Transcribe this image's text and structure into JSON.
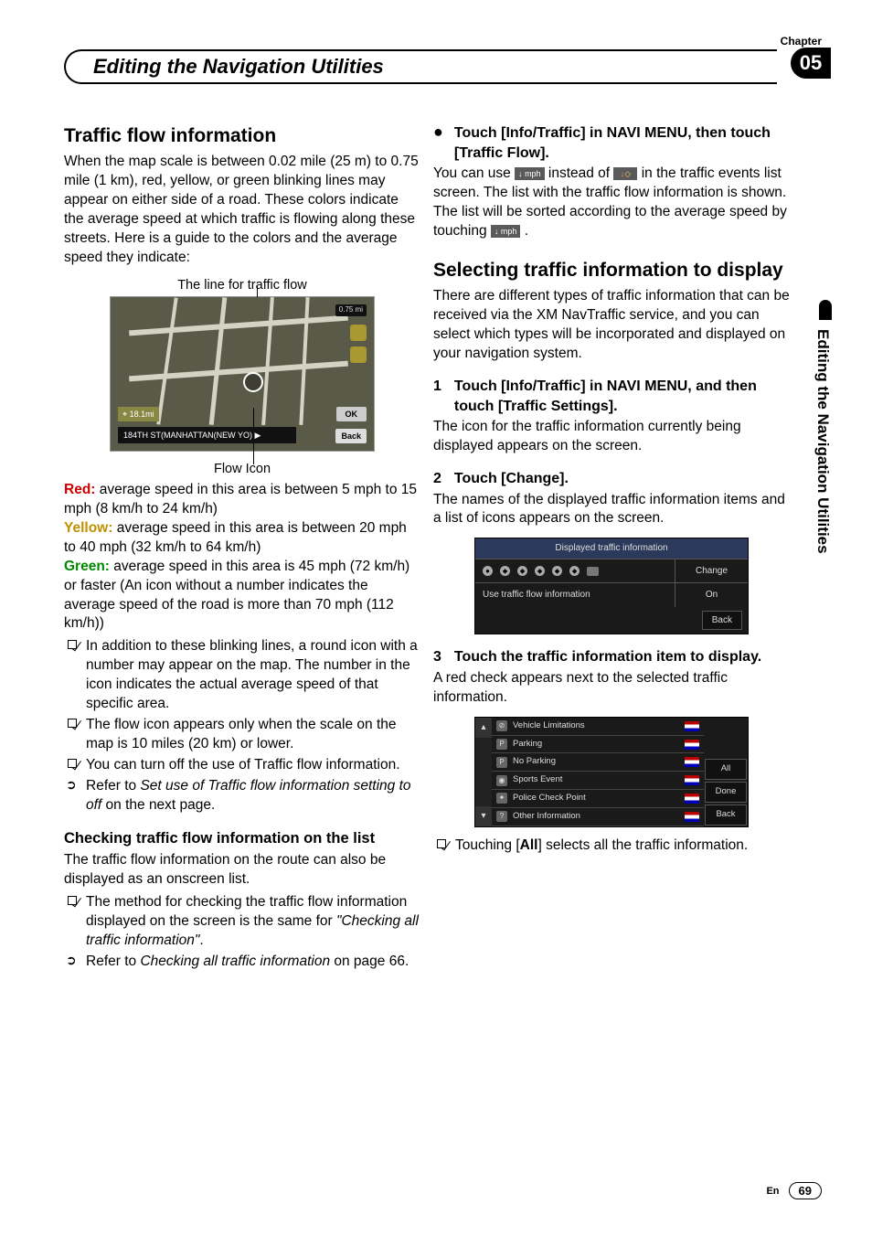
{
  "header": {
    "chapter_label": "Chapter",
    "chapter_number": "05",
    "title": "Editing the Navigation Utilities"
  },
  "side_tab": "Editing the Navigation Utilities",
  "left": {
    "h_traffic": "Traffic flow information",
    "p1": "When the map scale is between 0.02 mile (25 m) to 0.75 mile (1 km), red, yellow, or green blinking lines may appear on either side of a road. These colors indicate the average speed at which traffic is flowing along these streets. Here is a guide to the colors and the average speed they indicate:",
    "fig1_caption_top": "The line for traffic flow",
    "fig1_caption_bottom": "Flow Icon",
    "map": {
      "scale": "0.75 mi",
      "dist": "⌖ 18.1mi",
      "street": "184TH ST(MANHATTAN(NEW YO) ▶",
      "ok": "OK",
      "back": "Back"
    },
    "red_label": "Red:",
    "red_text": " average speed in this area is between 5 mph to 15 mph (8 km/h to 24 km/h)",
    "yellow_label": "Yellow:",
    "yellow_text": " average speed in this area is between 20 mph to 40 mph (32 km/h to 64 km/h)",
    "green_label": "Green:",
    "green_text": " average speed in this area is 45 mph (72 km/h) or faster (An icon without a number indicates the average speed of the road is more than 70 mph (112 km/h))",
    "notes": [
      "In addition to these blinking lines, a round icon with a number may appear on the map. The number in the icon indicates the actual average speed of that specific area.",
      "The flow icon appears only when the scale on the map is 10 miles (20 km) or lower.",
      "You can turn off the use of Traffic flow information."
    ],
    "refer1a": "Refer to ",
    "refer1b": "Set use of Traffic flow information setting to off",
    "refer1c": " on the next page.",
    "h_checking": "Checking traffic flow information on the list",
    "p_checking": "The traffic flow information on the route can also be displayed as an onscreen list.",
    "note_checking_a": "The method for checking the traffic flow information displayed on the screen is the same for ",
    "note_checking_b": "\"Checking all traffic information\"",
    "note_checking_c": ".",
    "refer2a": "Refer to ",
    "refer2b": "Checking all traffic information",
    "refer2c": " on page 66."
  },
  "right": {
    "step_bullet": "Touch [Info/Traffic] in NAVI MENU, then touch [Traffic Flow].",
    "p_use_a": "You can use ",
    "p_use_b": " instead of ",
    "p_use_c": " in the traffic events list screen. The list with the traffic flow information is shown.",
    "p_sort_a": "The list will be sorted according to the average speed by touching ",
    "p_sort_b": ".",
    "icon_mph": "↓ mph",
    "icon_diamond": "↓ ◇",
    "h_select": "Selecting traffic information to display",
    "p_select": "There are different types of traffic information that can be received via the XM NavTraffic service, and you can select which types will be incorporated and displayed on your navigation system.",
    "step1": "Touch [Info/Traffic] in NAVI MENU, and then touch [Traffic Settings].",
    "p_step1": "The icon for the traffic information currently being displayed appears on the screen.",
    "step2": "Touch [Change].",
    "p_step2": "The names of the displayed traffic information items and a list of icons appears on the screen.",
    "screen1": {
      "title": "Displayed traffic information",
      "change": "Change",
      "row_label": "Use traffic flow information",
      "row_value": "On",
      "back": "Back"
    },
    "step3": "Touch the traffic information item to display.",
    "p_step3": "A red check appears next to the selected traffic information.",
    "screen2": {
      "items": [
        "Vehicle Limitations",
        "Parking",
        "No Parking",
        "Sports Event",
        "Police Check Point",
        "Other Information"
      ],
      "all": "All",
      "done": "Done",
      "back": "Back"
    },
    "note_all_a": "Touching [",
    "note_all_b": "All",
    "note_all_c": "] selects all the traffic information."
  },
  "footer": {
    "lang": "En",
    "page": "69"
  }
}
